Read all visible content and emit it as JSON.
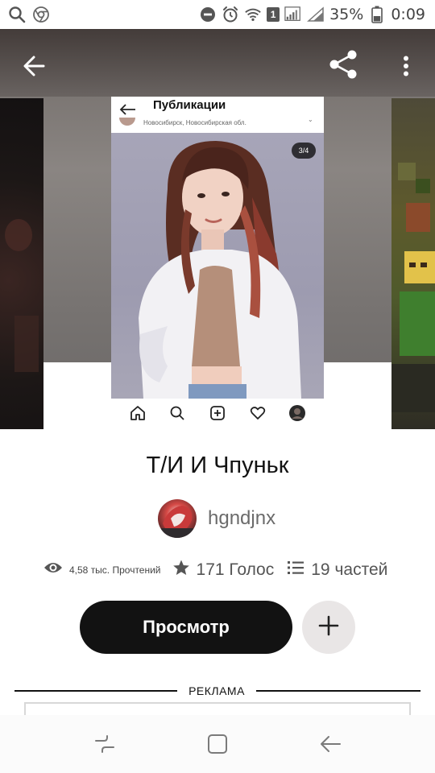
{
  "status_bar": {
    "battery": "35%",
    "time": "0:09",
    "sim_badge": "1",
    "icons": [
      "search-icon",
      "chrome-icon",
      "do-not-disturb-icon",
      "alarm-icon",
      "wifi-icon",
      "signal-icon",
      "battery-icon"
    ]
  },
  "header": {
    "back_icon": "arrow-left-icon",
    "share_icon": "share-icon",
    "more_icon": "more-vertical-icon"
  },
  "cover": {
    "title": "Публикации",
    "location": "Новосибирск, Новосибирская обл.",
    "counter": "3/4",
    "nav_icons": [
      "home-icon",
      "search-icon",
      "add-post-icon",
      "heart-icon",
      "profile-icon"
    ]
  },
  "story": {
    "title": "Т/И И Чпуньк",
    "author": "hgndjnx",
    "reads": "4,58 тыс. Прочтений",
    "votes": "171 Голос",
    "parts": "19 частей"
  },
  "actions": {
    "view_label": "Просмотр",
    "add_icon": "plus-icon"
  },
  "ad": {
    "label": "РЕКЛАМА"
  },
  "system_nav": {
    "icons": [
      "recent-apps-icon",
      "home-button-icon",
      "back-button-icon"
    ]
  }
}
